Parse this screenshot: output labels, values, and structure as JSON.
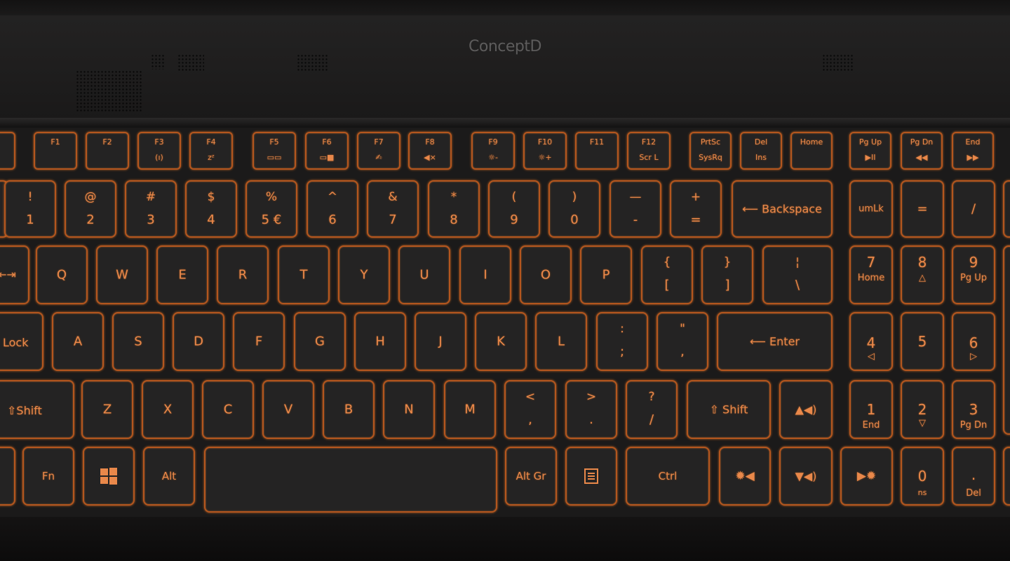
{
  "brand": "ConceptD",
  "fn_row": [
    {
      "name": "f1",
      "top": "F1",
      "bottom": ""
    },
    {
      "name": "f2",
      "top": "F2",
      "bottom": ""
    },
    {
      "name": "f3",
      "top": "F3",
      "bottom": "(ı)"
    },
    {
      "name": "f4",
      "top": "F4",
      "bottom": "zᶻ"
    },
    {
      "name": "f5",
      "top": "F5",
      "bottom": "▭▭"
    },
    {
      "name": "f6",
      "top": "F6",
      "bottom": "▭■"
    },
    {
      "name": "f7",
      "top": "F7",
      "bottom": "✍"
    },
    {
      "name": "f8",
      "top": "F8",
      "bottom": "◀×"
    },
    {
      "name": "f9",
      "top": "F9",
      "bottom": "☼-"
    },
    {
      "name": "f10",
      "top": "F10",
      "bottom": "☼+"
    },
    {
      "name": "f11",
      "top": "F11",
      "bottom": ""
    },
    {
      "name": "f12",
      "top": "F12",
      "bottom": "Scr L"
    },
    {
      "name": "prtsc",
      "top": "PrtSc",
      "bottom": "SysRq"
    },
    {
      "name": "del-ins",
      "top": "Del",
      "bottom": "Ins"
    },
    {
      "name": "home",
      "top": "Home",
      "bottom": ""
    },
    {
      "name": "pgup",
      "top": "Pg Up",
      "bottom": "▶II"
    },
    {
      "name": "pgdn",
      "top": "Pg Dn",
      "bottom": "◀◀"
    },
    {
      "name": "end",
      "top": "End",
      "bottom": "▶▶"
    }
  ],
  "number_row": [
    {
      "name": "1",
      "top": "!",
      "bottom": "1"
    },
    {
      "name": "2",
      "top": "@",
      "bottom": "2"
    },
    {
      "name": "3",
      "top": "#",
      "bottom": "3"
    },
    {
      "name": "4",
      "top": "$",
      "bottom": "4"
    },
    {
      "name": "5",
      "top": "%",
      "bottom": "5 €"
    },
    {
      "name": "6",
      "top": "^",
      "bottom": "6"
    },
    {
      "name": "7",
      "top": "&",
      "bottom": "7"
    },
    {
      "name": "8",
      "top": "*",
      "bottom": "8"
    },
    {
      "name": "9",
      "top": "(",
      "bottom": "9"
    },
    {
      "name": "0",
      "top": ")",
      "bottom": "0"
    },
    {
      "name": "minus",
      "top": "—",
      "bottom": "-"
    },
    {
      "name": "equals",
      "top": "+",
      "bottom": "="
    }
  ],
  "backspace": "⟵ Backspace",
  "numpad_row1": [
    "umLk",
    "=",
    "/"
  ],
  "tab_label": "⇤⇥",
  "qwerty_row": [
    "Q",
    "W",
    "E",
    "R",
    "T",
    "Y",
    "U",
    "I",
    "O",
    "P"
  ],
  "bracket_keys": [
    {
      "name": "left-bracket",
      "top": "{",
      "bottom": "["
    },
    {
      "name": "right-bracket",
      "top": "}",
      "bottom": "]"
    },
    {
      "name": "backslash",
      "top": "¦",
      "bottom": "\\"
    }
  ],
  "numpad_row2": [
    {
      "name": "7",
      "main": "7",
      "sub": "Home"
    },
    {
      "name": "8",
      "main": "8",
      "sub": "△"
    },
    {
      "name": "9",
      "main": "9",
      "sub": "Pg Up"
    }
  ],
  "caps_label": "Lock",
  "home_row": [
    "A",
    "S",
    "D",
    "F",
    "G",
    "H",
    "J",
    "K",
    "L"
  ],
  "semicolon": {
    "top": ":",
    "bottom": ";"
  },
  "quote": {
    "top": "\"",
    "bottom": ","
  },
  "enter": "⟵ Enter",
  "numpad_row3": [
    {
      "name": "4",
      "main": "4",
      "sub": "◁"
    },
    {
      "name": "5",
      "main": "5",
      "sub": ""
    },
    {
      "name": "6",
      "main": "6",
      "sub": "▷"
    }
  ],
  "lshift": "⇧Shift",
  "bottom_row": [
    "Z",
    "X",
    "C",
    "V",
    "B",
    "N",
    "M"
  ],
  "comma": {
    "top": "<",
    "bottom": ","
  },
  "period": {
    "top": ">",
    "bottom": "."
  },
  "slash": {
    "top": "?",
    "bottom": "/"
  },
  "rshift": "⇧ Shift",
  "vol_up": "▲◀)",
  "numpad_row4": [
    {
      "name": "1",
      "main": "1",
      "sub": "End"
    },
    {
      "name": "2",
      "main": "2",
      "sub": "▽"
    },
    {
      "name": "3",
      "main": "3",
      "sub": "Pg Dn"
    }
  ],
  "fn": "Fn",
  "alt": "Alt",
  "altgr": "Alt Gr",
  "ctrl": "Ctrl",
  "arrow_left": "✹◀",
  "arrow_down": "▼◀)",
  "arrow_right": "▶✹",
  "numpad_0": {
    "main": "0",
    "sub": "ns"
  },
  "numpad_dot": {
    "main": ".",
    "sub": "Del"
  },
  "colors": {
    "glow": "#e9884a",
    "border": "#b4561e",
    "keycap": "#242323",
    "body": "#1b1a1a"
  }
}
